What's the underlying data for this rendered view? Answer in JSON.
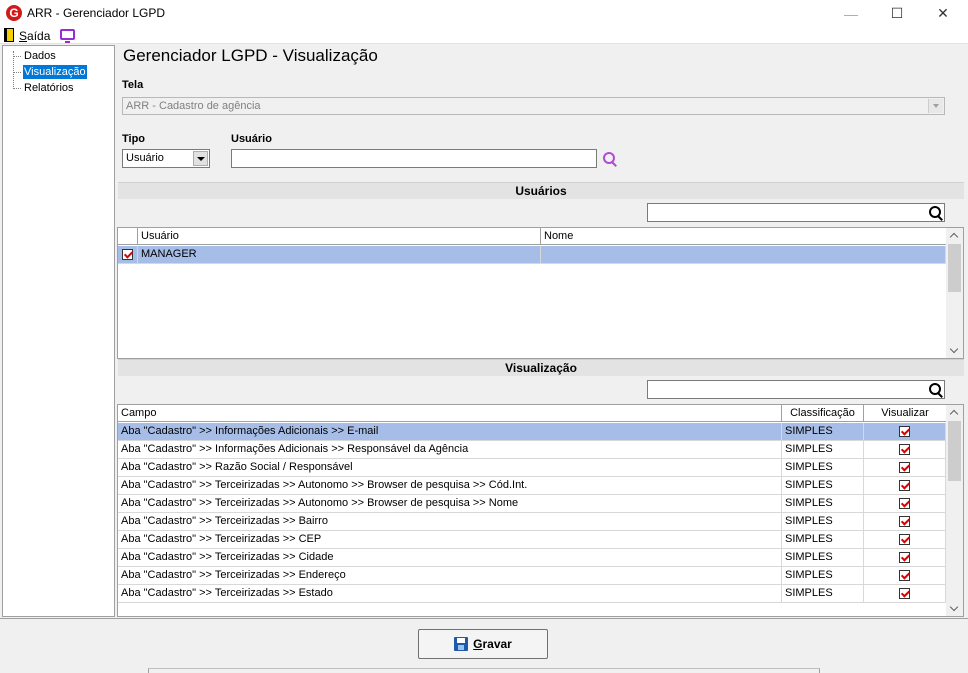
{
  "window": {
    "title": "ARR - Gerenciador LGPD",
    "app_icon_letter": "G"
  },
  "menu": {
    "exit_label_first": "S",
    "exit_label_rest": "aída"
  },
  "tree": {
    "items": [
      "Dados",
      "Visualização",
      "Relatórios"
    ],
    "selected": "Visualização"
  },
  "page": {
    "title": "Gerenciador LGPD - Visualização"
  },
  "form": {
    "tela_label": "Tela",
    "tela_value": "ARR - Cadastro de agência",
    "tipo_label": "Tipo",
    "tipo_value": "Usuário",
    "usuario_label": "Usuário",
    "usuario_value": ""
  },
  "users_section": {
    "title": "Usuários",
    "filter_value": "",
    "columns": [
      "Usuário",
      "Nome"
    ],
    "rows": [
      {
        "checked": true,
        "usuario": "MANAGER",
        "nome": ""
      }
    ]
  },
  "view_section": {
    "title": "Visualização",
    "filter_value": "",
    "columns": [
      "Campo",
      "Classificação",
      "Visualizar"
    ],
    "rows": [
      {
        "campo": "Aba \"Cadastro\" >> Informações Adicionais >> E-mail",
        "classificacao": "SIMPLES",
        "visualizar": true
      },
      {
        "campo": "Aba \"Cadastro\" >> Informações Adicionais >> Responsável da Agência",
        "classificacao": "SIMPLES",
        "visualizar": true
      },
      {
        "campo": "Aba \"Cadastro\" >> Razão Social / Responsável",
        "classificacao": "SIMPLES",
        "visualizar": true
      },
      {
        "campo": "Aba \"Cadastro\" >> Terceirizadas >> Autonomo >> Browser de pesquisa >> Cód.Int.",
        "classificacao": "SIMPLES",
        "visualizar": true
      },
      {
        "campo": "Aba \"Cadastro\" >> Terceirizadas >> Autonomo >> Browser de pesquisa >> Nome",
        "classificacao": "SIMPLES",
        "visualizar": true
      },
      {
        "campo": "Aba \"Cadastro\" >> Terceirizadas >> Bairro",
        "classificacao": "SIMPLES",
        "visualizar": true
      },
      {
        "campo": "Aba \"Cadastro\" >> Terceirizadas >> CEP",
        "classificacao": "SIMPLES",
        "visualizar": true
      },
      {
        "campo": "Aba \"Cadastro\" >> Terceirizadas >> Cidade",
        "classificacao": "SIMPLES",
        "visualizar": true
      },
      {
        "campo": "Aba \"Cadastro\" >> Terceirizadas >> Endereço",
        "classificacao": "SIMPLES",
        "visualizar": true
      },
      {
        "campo": "Aba \"Cadastro\" >> Terceirizadas >> Estado",
        "classificacao": "SIMPLES",
        "visualizar": true
      }
    ]
  },
  "footer": {
    "save_first": "G",
    "save_rest": "ravar"
  },
  "colors": {
    "selection": "#a6bde8",
    "tree_selection": "#0078d7",
    "check": "#dd0000",
    "search_icon_purple": "#b04ad6"
  }
}
